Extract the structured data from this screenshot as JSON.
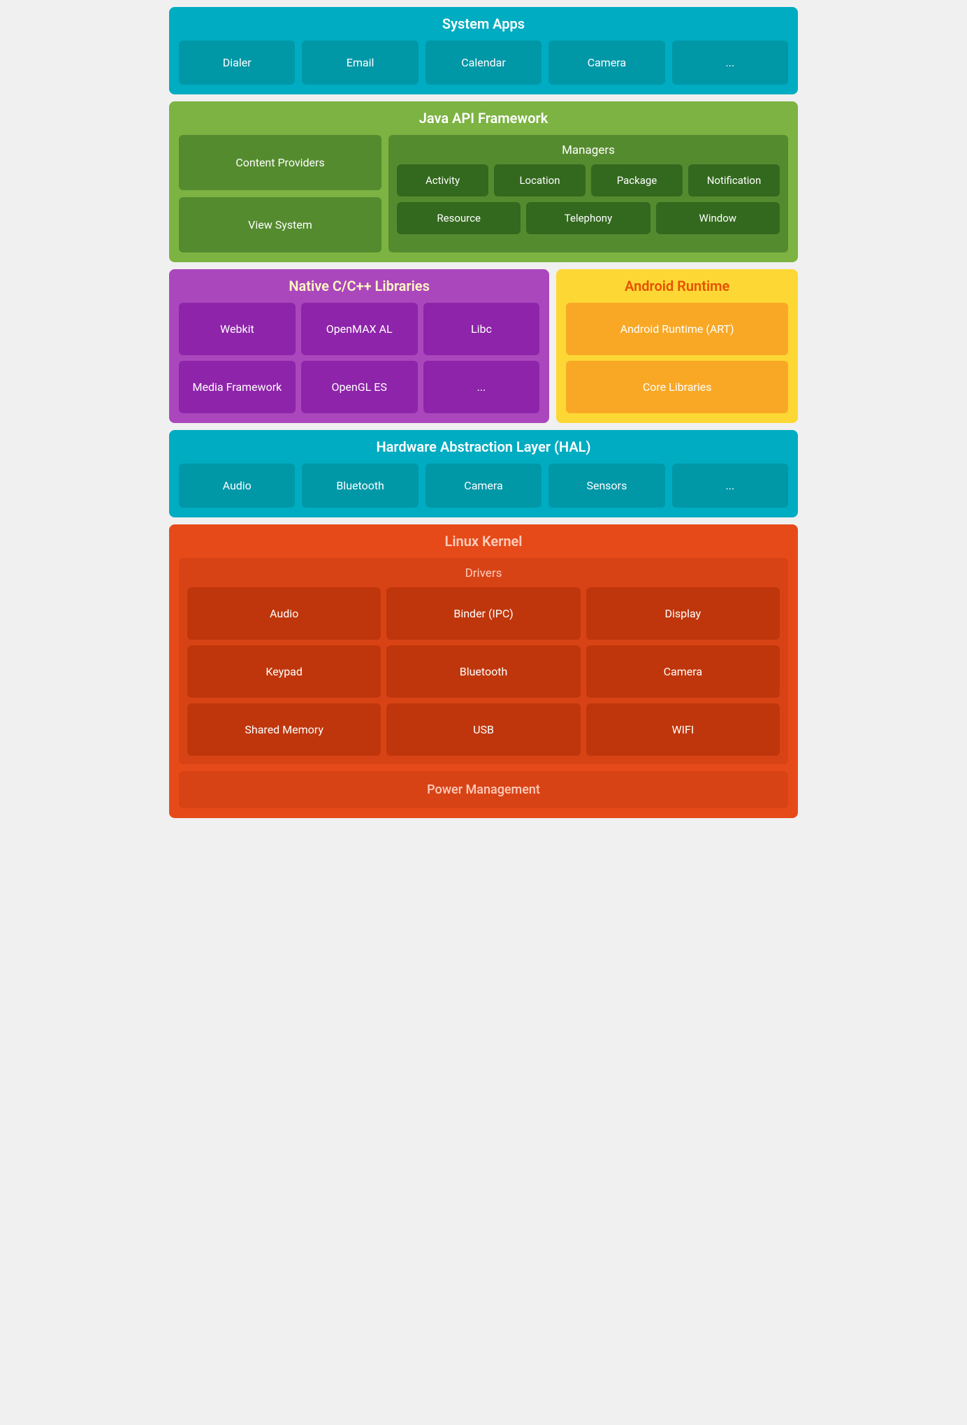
{
  "system_apps": {
    "title": "System Apps",
    "items": [
      "Dialer",
      "Email",
      "Calendar",
      "Camera",
      "..."
    ]
  },
  "java_api": {
    "title": "Java API Framework",
    "left": [
      "Content Providers",
      "View System"
    ],
    "managers": {
      "title": "Managers",
      "row1": [
        "Activity",
        "Location",
        "Package",
        "Notification"
      ],
      "row2": [
        "Resource",
        "Telephony",
        "Window"
      ]
    }
  },
  "native_libs": {
    "title": "Native C/C++ Libraries",
    "row1": [
      "Webkit",
      "OpenMAX AL",
      "Libc"
    ],
    "row2": [
      "Media Framework",
      "OpenGL ES",
      "..."
    ]
  },
  "android_runtime": {
    "title": "Android Runtime",
    "items": [
      "Android Runtime (ART)",
      "Core Libraries"
    ]
  },
  "hal": {
    "title": "Hardware Abstraction Layer (HAL)",
    "items": [
      "Audio",
      "Bluetooth",
      "Camera",
      "Sensors",
      "..."
    ]
  },
  "linux_kernel": {
    "title": "Linux Kernel",
    "drivers_title": "Drivers",
    "drivers": {
      "row1": [
        "Audio",
        "Binder (IPC)",
        "Display"
      ],
      "row2": [
        "Keypad",
        "Bluetooth",
        "Camera"
      ],
      "row3": [
        "Shared Memory",
        "USB",
        "WIFI"
      ]
    },
    "power_management": "Power Management"
  }
}
